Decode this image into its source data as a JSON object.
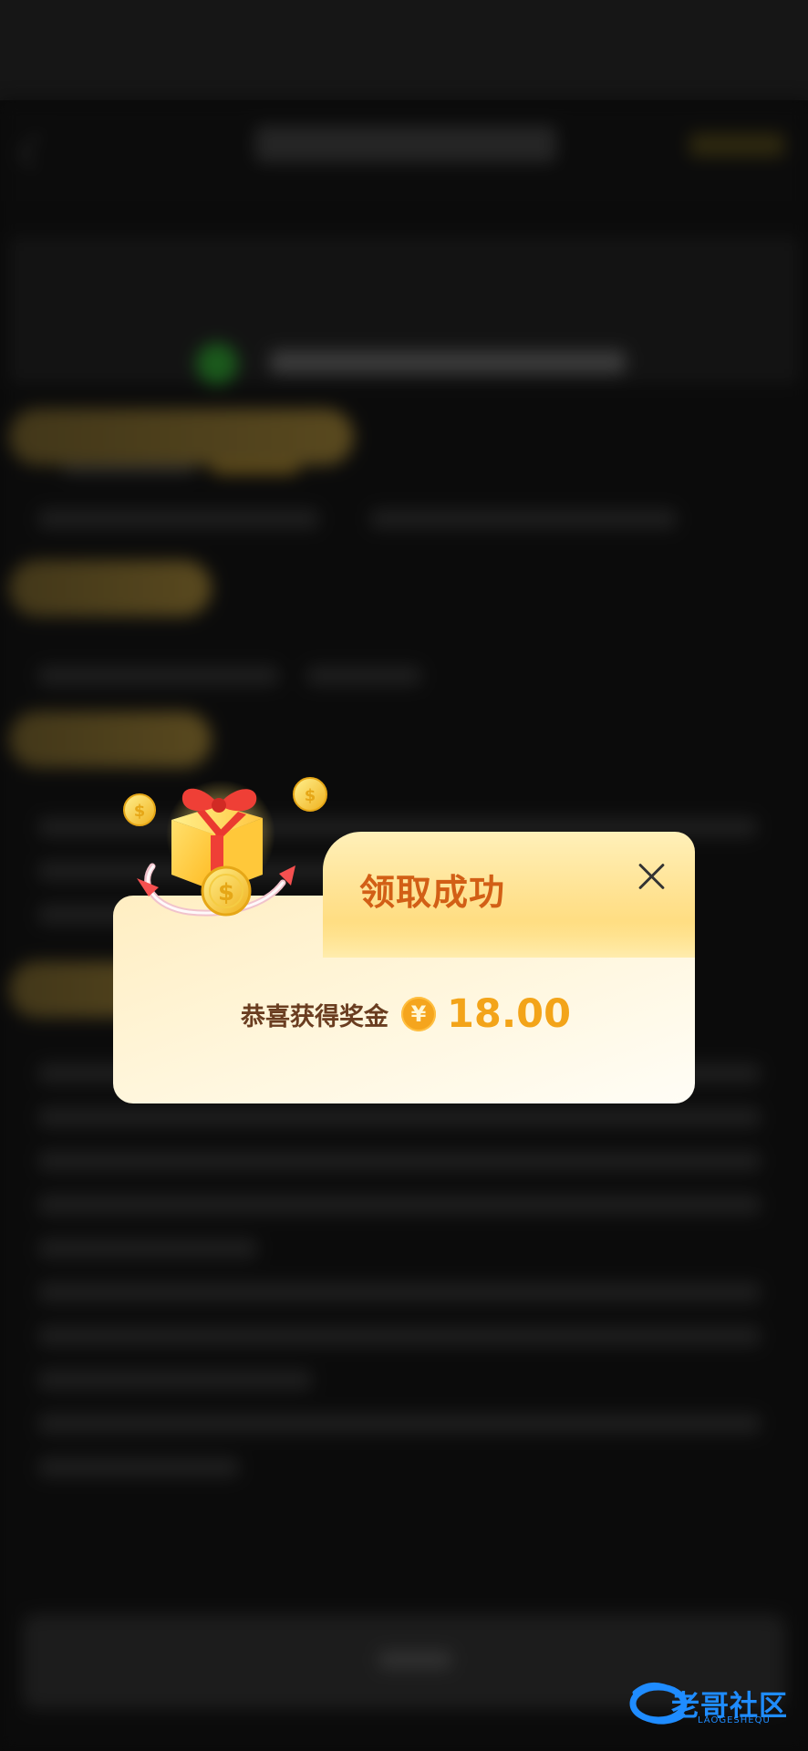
{
  "dialog": {
    "title": "领取成功",
    "reward_label": "恭喜获得奖金",
    "currency_symbol": "¥",
    "amount": "18.00",
    "close_icon": "close-icon"
  },
  "decor": {
    "gift_icon": "gift-icon",
    "coin_icon": "coin-icon"
  },
  "watermark": {
    "text": "老哥社区",
    "subtext": "LAOGESHEQU"
  },
  "colors": {
    "title": "#d25f16",
    "amount": "#f3a419",
    "watermark": "#1f8cff"
  }
}
